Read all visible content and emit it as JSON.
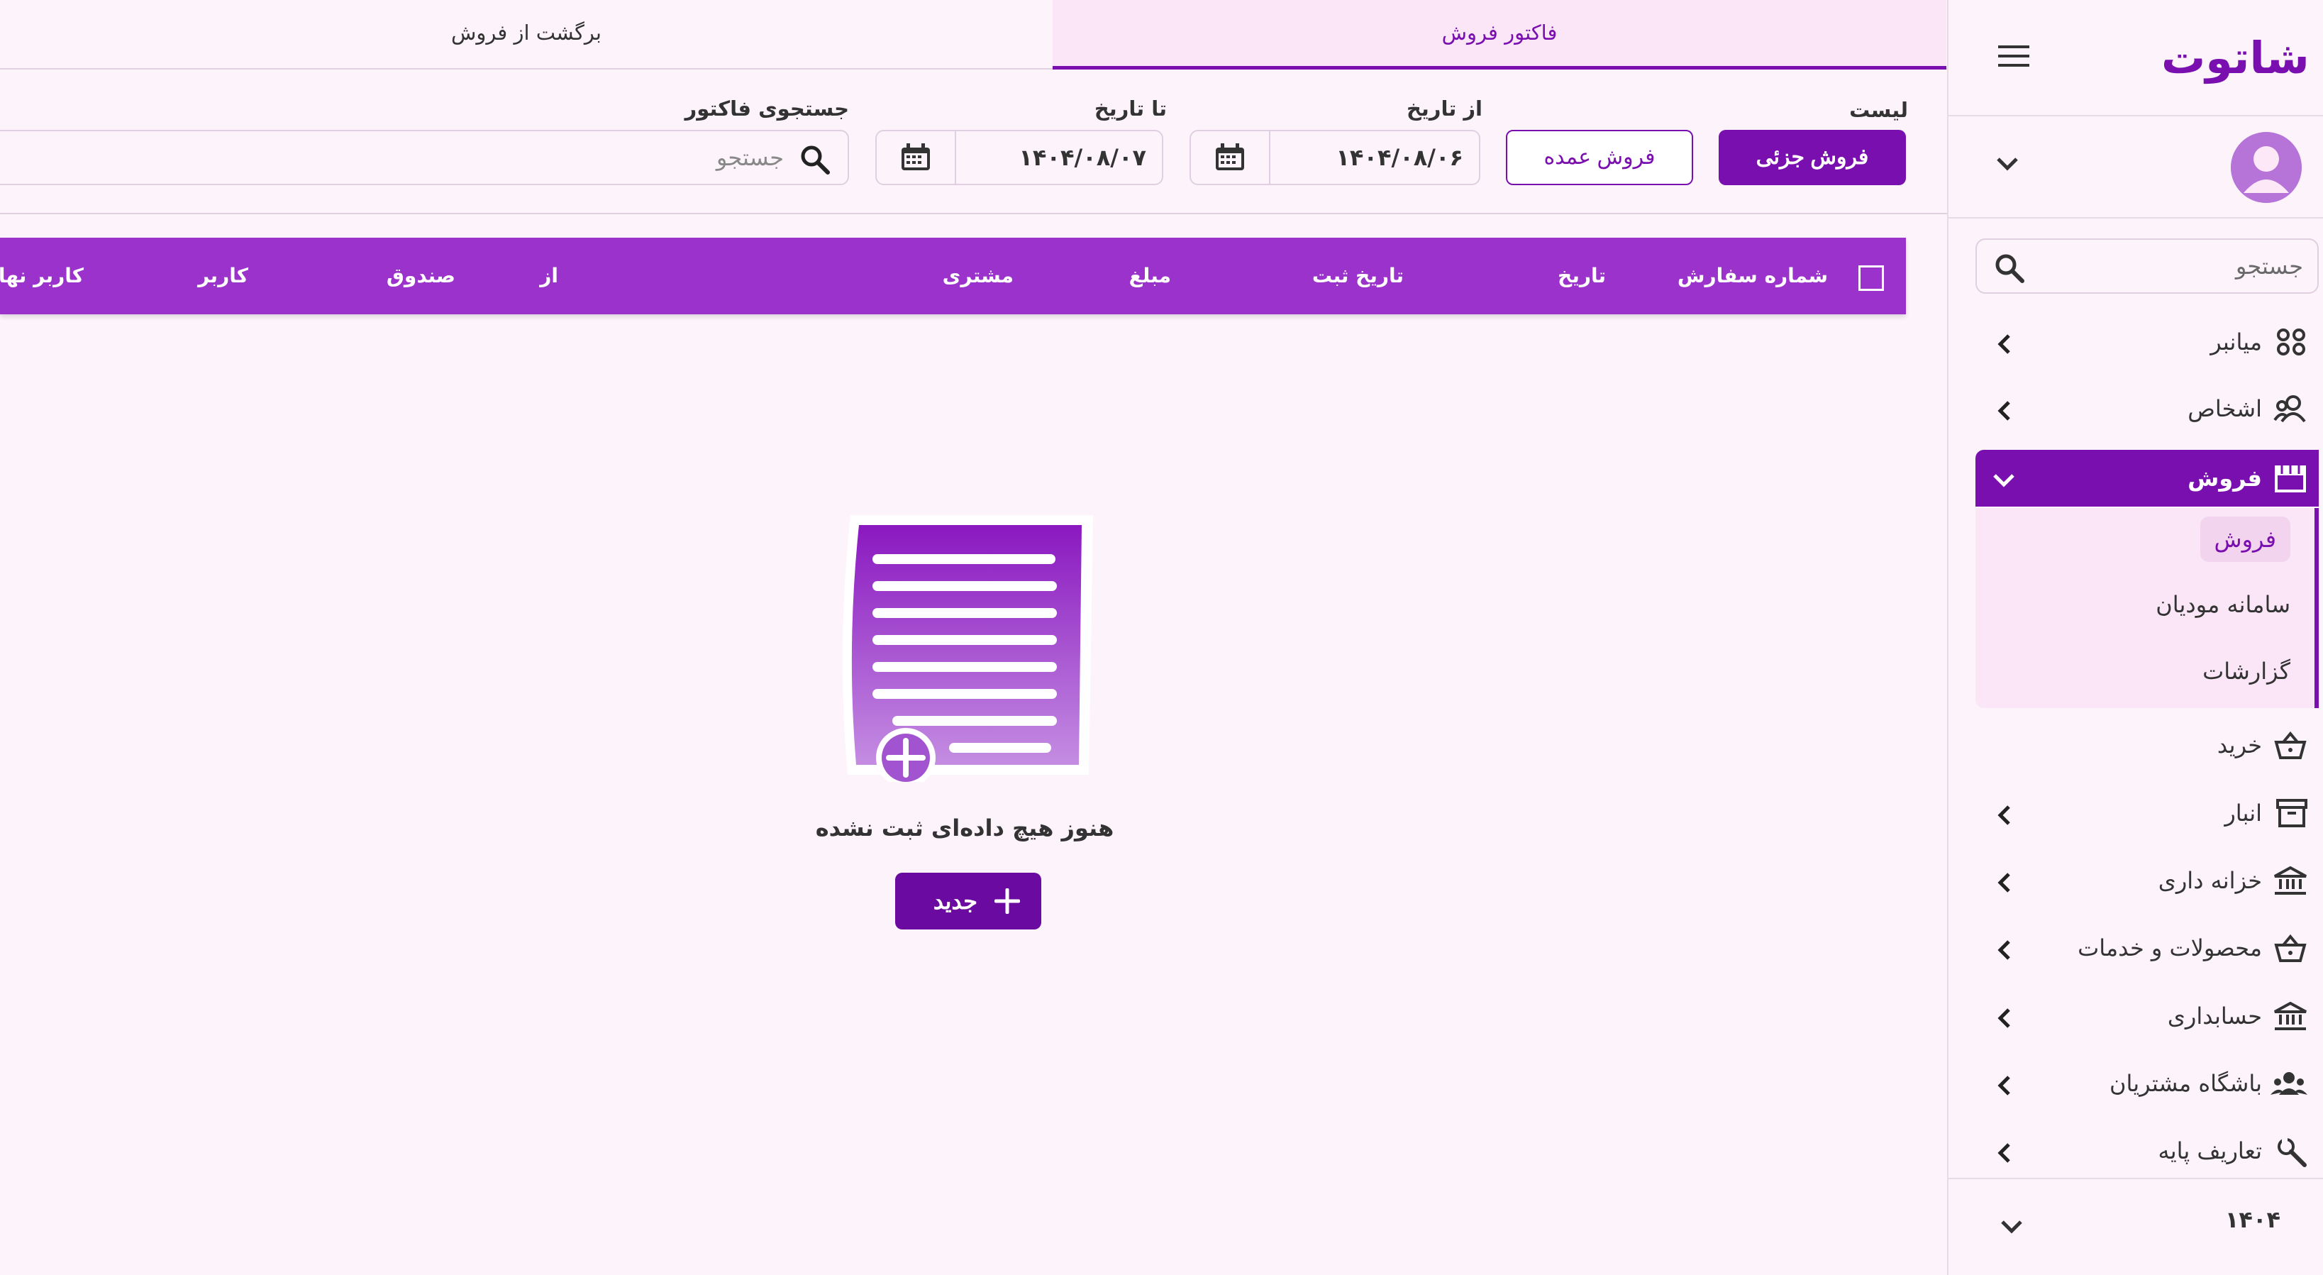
{
  "app": {
    "logo_text": "شاتوت"
  },
  "colors": {
    "accent": "#7a0fb0",
    "header": "#9b32cc",
    "background": "#fdf4fb"
  },
  "tabs": [
    {
      "label": "فاکتور فروش",
      "active": true
    },
    {
      "label": "برگشت از فروش",
      "active": false
    }
  ],
  "filters": {
    "list_label": "لیست",
    "retail_button": "فروش جزئی",
    "wholesale_button": "فروش عمده",
    "from_date_label": "از تاریخ",
    "from_date_value": "۱۴۰۴/۰۸/۰۶",
    "to_date_label": "تا تاریخ",
    "to_date_value": "۱۴۰۴/۰۸/۰۷",
    "search_label": "جستجوی فاکتور",
    "search_placeholder": "جستجو"
  },
  "table": {
    "columns": [
      "شماره سفارش",
      "تاریخ",
      "تاریخ ثبت",
      "مبلغ",
      "مشتری",
      "از",
      "صندوق",
      "کاربر",
      "کاربر نهایی"
    ]
  },
  "empty_state": {
    "message": "هنوز هیچ داده‌ای ثبت نشده",
    "new_button": "جدید"
  },
  "sidebar": {
    "search_placeholder": "جستجو",
    "items": [
      {
        "label": "میانبر",
        "icon": "shortcuts-icon"
      },
      {
        "label": "اشخاص",
        "icon": "people-icon"
      },
      {
        "label": "فروش",
        "icon": "store-icon",
        "active": true
      },
      {
        "label": "خرید",
        "icon": "basket-icon"
      },
      {
        "label": "انبار",
        "icon": "archive-icon"
      },
      {
        "label": "خزانه داری",
        "icon": "bank-icon"
      },
      {
        "label": "محصولات و خدمات",
        "icon": "basket-icon"
      },
      {
        "label": "حسابداری",
        "icon": "bank-icon"
      },
      {
        "label": "باشگاه مشتریان",
        "icon": "group-icon"
      },
      {
        "label": "تعاریف پایه",
        "icon": "wrench-icon"
      }
    ],
    "sub_items": [
      "فروش",
      "سامانه مودیان",
      "گزارشات"
    ],
    "year": "۱۴۰۴"
  }
}
